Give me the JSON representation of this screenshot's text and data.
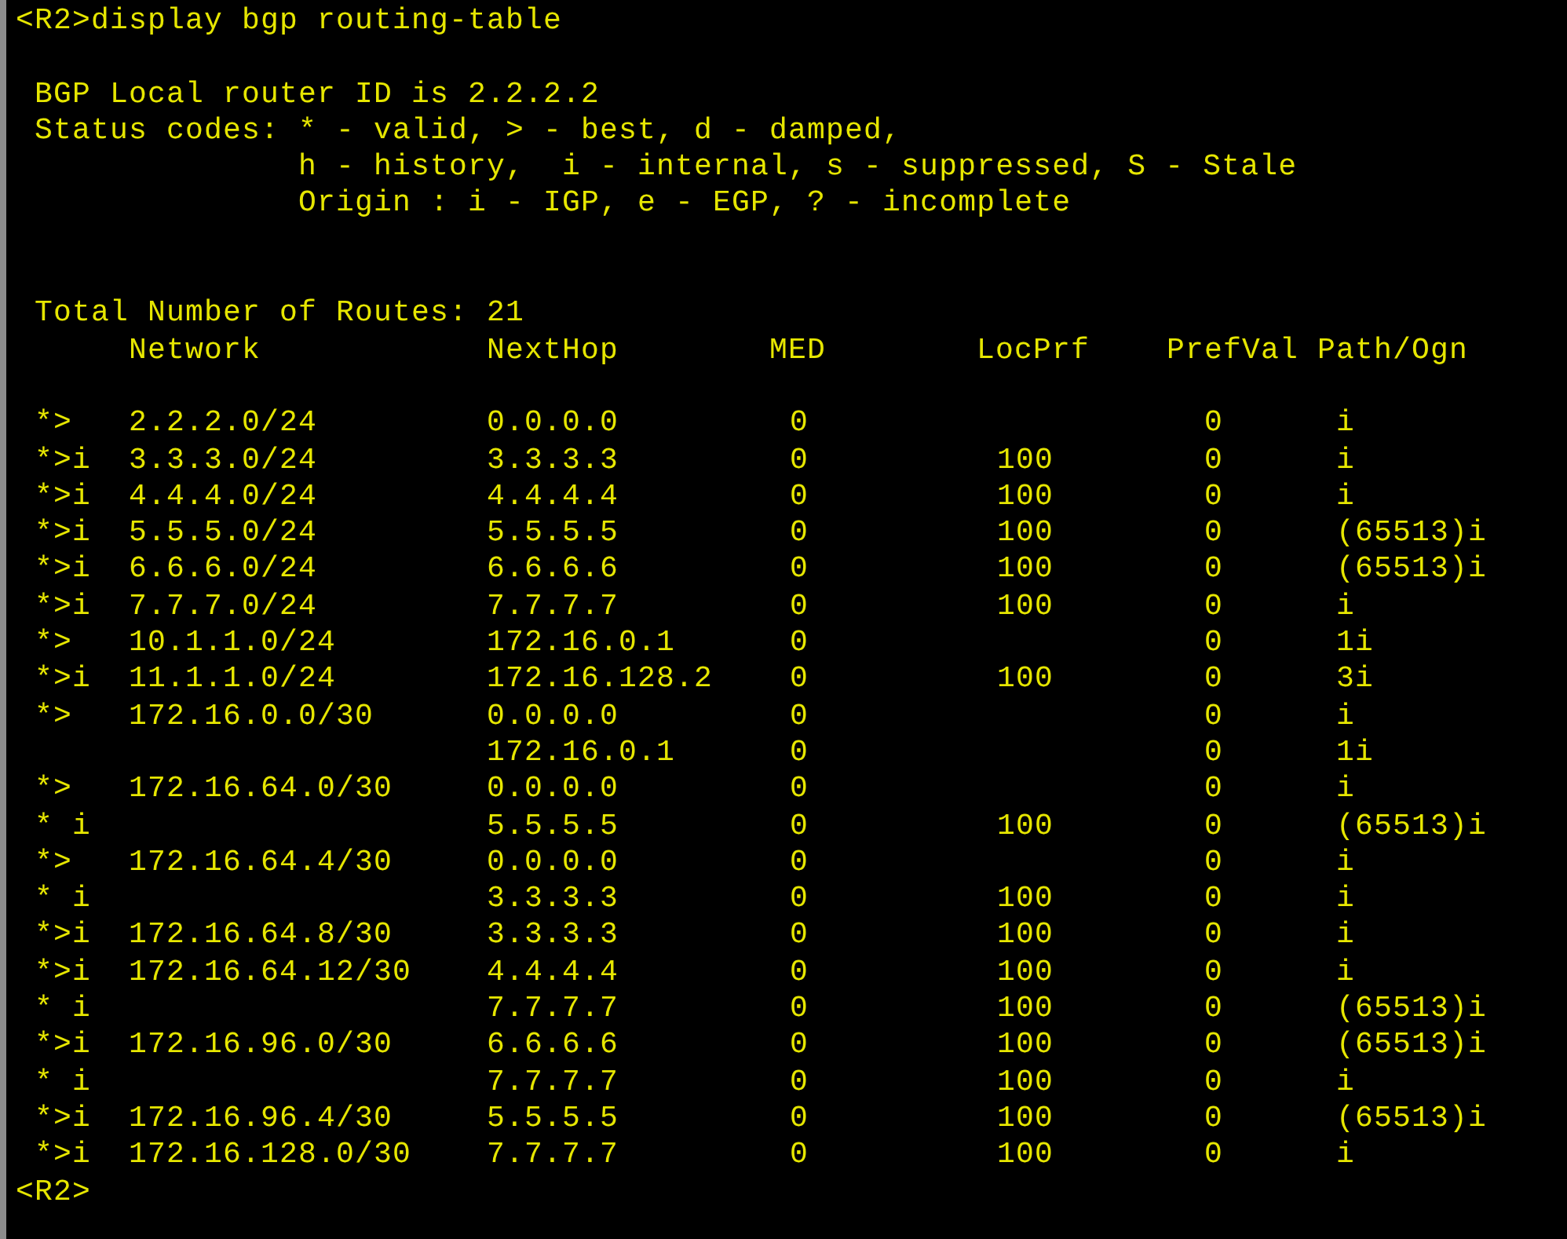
{
  "command": {
    "prompt": "<R2>",
    "text": "display bgp routing-table"
  },
  "router_id": "BGP Local router ID is 2.2.2.2",
  "status_codes": {
    "label": "Status codes:",
    "lines": [
      "* - valid, > - best, d - damped,",
      "h - history,  i - internal, s - suppressed, S - Stale",
      "Origin : i - IGP, e - EGP, ? - incomplete"
    ]
  },
  "total": "Total Number of Routes: 21",
  "table": {
    "columns": [
      "Network",
      "NextHop",
      "MED",
      "LocPrf",
      "PrefVal",
      "Path/Ogn"
    ],
    "rows": [
      {
        "status": "*>",
        "network": "2.2.2.0/24",
        "nexthop": "0.0.0.0",
        "med": "0",
        "prefval": "0",
        "path": "i"
      },
      {
        "status": "*>i",
        "network": "3.3.3.0/24",
        "nexthop": "3.3.3.3",
        "med": "0",
        "locprf": "100",
        "prefval": "0",
        "path": "i"
      },
      {
        "status": "*>i",
        "network": "4.4.4.0/24",
        "nexthop": "4.4.4.4",
        "med": "0",
        "locprf": "100",
        "prefval": "0",
        "path": "i"
      },
      {
        "status": "*>i",
        "network": "5.5.5.0/24",
        "nexthop": "5.5.5.5",
        "med": "0",
        "locprf": "100",
        "prefval": "0",
        "path": "(65513)i"
      },
      {
        "status": "*>i",
        "network": "6.6.6.0/24",
        "nexthop": "6.6.6.6",
        "med": "0",
        "locprf": "100",
        "prefval": "0",
        "path": "(65513)i"
      },
      {
        "status": "*>i",
        "network": "7.7.7.0/24",
        "nexthop": "7.7.7.7",
        "med": "0",
        "locprf": "100",
        "prefval": "0",
        "path": "i"
      },
      {
        "status": "*>",
        "network": "10.1.1.0/24",
        "nexthop": "172.16.0.1",
        "med": "0",
        "prefval": "0",
        "path": "1i"
      },
      {
        "status": "*>i",
        "network": "11.1.1.0/24",
        "nexthop": "172.16.128.2",
        "med": "0",
        "locprf": "100",
        "prefval": "0",
        "path": "3i"
      },
      {
        "status": "*>",
        "network": "172.16.0.0/30",
        "nexthop": "0.0.0.0",
        "med": "0",
        "prefval": "0",
        "path": "i"
      },
      {
        "nexthop": "172.16.0.1",
        "med": "0",
        "prefval": "0",
        "path": "1i"
      },
      {
        "status": "*>",
        "network": "172.16.64.0/30",
        "nexthop": "0.0.0.0",
        "med": "0",
        "prefval": "0",
        "path": "i"
      },
      {
        "status": "* i",
        "nexthop": "5.5.5.5",
        "med": "0",
        "locprf": "100",
        "prefval": "0",
        "path": "(65513)i"
      },
      {
        "status": "*>",
        "network": "172.16.64.4/30",
        "nexthop": "0.0.0.0",
        "med": "0",
        "prefval": "0",
        "path": "i"
      },
      {
        "status": "* i",
        "nexthop": "3.3.3.3",
        "med": "0",
        "locprf": "100",
        "prefval": "0",
        "path": "i"
      },
      {
        "status": "*>i",
        "network": "172.16.64.8/30",
        "nexthop": "3.3.3.3",
        "med": "0",
        "locprf": "100",
        "prefval": "0",
        "path": "i"
      },
      {
        "status": "*>i",
        "network": "172.16.64.12/30",
        "nexthop": "4.4.4.4",
        "med": "0",
        "locprf": "100",
        "prefval": "0",
        "path": "i"
      },
      {
        "status": "* i",
        "nexthop": "7.7.7.7",
        "med": "0",
        "locprf": "100",
        "prefval": "0",
        "path": "(65513)i"
      },
      {
        "status": "*>i",
        "network": "172.16.96.0/30",
        "nexthop": "6.6.6.6",
        "med": "0",
        "locprf": "100",
        "prefval": "0",
        "path": "(65513)i"
      },
      {
        "status": "* i",
        "nexthop": "7.7.7.7",
        "med": "0",
        "locprf": "100",
        "prefval": "0",
        "path": "i"
      },
      {
        "status": "*>i",
        "network": "172.16.96.4/30",
        "nexthop": "5.5.5.5",
        "med": "0",
        "locprf": "100",
        "prefval": "0",
        "path": "(65513)i"
      },
      {
        "status": "*>i",
        "network": "172.16.128.0/30",
        "nexthop": "7.7.7.7",
        "med": "0",
        "locprf": "100",
        "prefval": "0",
        "path": "i"
      }
    ]
  },
  "next_prompt": "<R2>"
}
